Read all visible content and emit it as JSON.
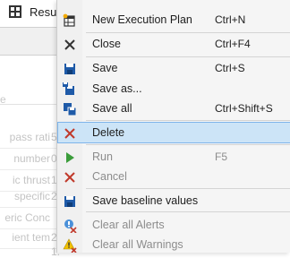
{
  "background": {
    "tab": {
      "label": "Result Ch",
      "close": "×"
    },
    "input_partial": "e",
    "rows": [
      {
        "name": "pass rati",
        "value": "5."
      },
      {
        "name": "number",
        "value": "0."
      },
      {
        "name": "ic thrust",
        "value": "1."
      },
      {
        "name": "specific",
        "value": "2."
      },
      {
        "name": "eric Conc",
        "value": ""
      },
      {
        "name": "ient tem",
        "value": "2."
      },
      {
        "name": "",
        "value": "1."
      }
    ]
  },
  "menu": {
    "items": [
      {
        "label": "New Execution Plan",
        "shortcut": "Ctrl+N",
        "icon": "new-plan-icon",
        "enabled": true
      },
      {
        "label": "Close",
        "shortcut": "Ctrl+F4",
        "icon": "close-icon",
        "enabled": true
      },
      {
        "label": "Save",
        "shortcut": "Ctrl+S",
        "icon": "save-icon",
        "enabled": true
      },
      {
        "label": "Save as...",
        "shortcut": "",
        "icon": "save-as-icon",
        "enabled": true
      },
      {
        "label": "Save all",
        "shortcut": "Ctrl+Shift+S",
        "icon": "save-all-icon",
        "enabled": true
      },
      {
        "label": "Delete",
        "shortcut": "",
        "icon": "delete-icon",
        "enabled": true,
        "highlighted": true
      },
      {
        "label": "Run",
        "shortcut": "F5",
        "icon": "run-icon",
        "enabled": false
      },
      {
        "label": "Cancel",
        "shortcut": "",
        "icon": "cancel-icon",
        "enabled": false
      },
      {
        "label": "Save baseline values",
        "shortcut": "",
        "icon": "save-baseline-icon",
        "enabled": true
      },
      {
        "label": "Clear all Alerts",
        "shortcut": "",
        "icon": "clear-alerts-icon",
        "enabled": false
      },
      {
        "label": "Clear all Warnings",
        "shortcut": "",
        "icon": "clear-warnings-icon",
        "enabled": false
      }
    ]
  },
  "colors": {
    "highlight_bg": "#cce4f7",
    "highlight_border": "#7eb4ea",
    "menu_bg": "#f5f5f5",
    "save_blue": "#1e5aa8",
    "delete_red": "#c0392b",
    "run_green": "#3a9c3a",
    "warning_yellow": "#f2c200"
  }
}
